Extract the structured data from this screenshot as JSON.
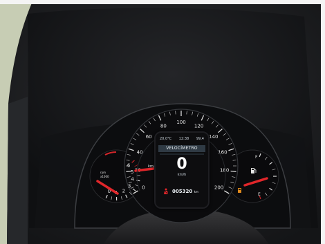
{
  "speedometer": {
    "ticks": [
      {
        "label": "0"
      },
      {
        "label": "20"
      },
      {
        "label": "40"
      },
      {
        "label": "60"
      },
      {
        "label": "80"
      },
      {
        "label": "100"
      },
      {
        "label": "120"
      },
      {
        "label": "140"
      },
      {
        "label": "160"
      },
      {
        "label": "180"
      },
      {
        "label": "200"
      }
    ],
    "unit": "km/h",
    "needle_value": 0
  },
  "tachometer": {
    "ticks": [
      {
        "label": "0"
      },
      {
        "label": "1"
      },
      {
        "label": "2"
      },
      {
        "label": "3"
      },
      {
        "label": "4"
      },
      {
        "label": "5"
      },
      {
        "label": "6"
      }
    ],
    "unit_top": "rpm",
    "unit_bottom": "x1000"
  },
  "fuel_gauge": {
    "full_label": "F",
    "empty_label": "E"
  },
  "display": {
    "temperature": "20,0°C",
    "time": "12:38",
    "trip": "99,4",
    "title": "VELOCÍMETRO",
    "speed": "0",
    "speed_unit": "km/h",
    "odometer": "005320",
    "odometer_unit": "km"
  },
  "colors": {
    "needle": "#e0262a",
    "redline": "#d3262a",
    "scale_text": "#e6e6e6",
    "fuel_warning": "#e08a1c"
  },
  "icons": {
    "seatbelt": "seatbelt-warning-icon",
    "fuel": "fuel-pump-icon",
    "fuel_warning": "low-fuel-warning-icon"
  }
}
